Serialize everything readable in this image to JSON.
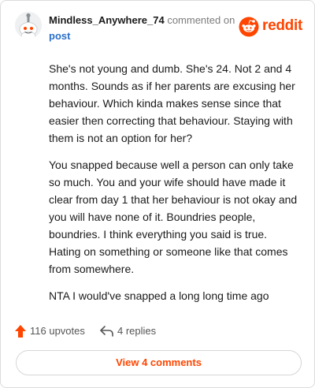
{
  "comment": {
    "username": "Mindless_Anywhere_74",
    "action": "commented on",
    "post_link": "post",
    "brand": "reddit",
    "paragraphs": [
      "She's not young and dumb. She's 24. Not 2 and 4 months. Sounds as if her parents are excusing her behaviour. Which kinda makes sense since that easier then correcting that behaviour. Staying with them is not an option for her?",
      "You snapped because well a person can only take so much. You and your wife should have made it clear from day 1 that her behaviour is not okay and you will have none of it. Boundries people, boundries. I think everything you said is true. Hating on something or someone like that comes from somewhere.",
      "NTA I would've snapped a long long time ago"
    ]
  },
  "stats": {
    "upvotes": "116 upvotes",
    "replies": "4 replies"
  },
  "actions": {
    "view_comments": "View 4 comments"
  },
  "colors": {
    "brand": "#ff4500",
    "link": "#2b6fc9",
    "text": "#1a1a1b",
    "muted": "#7c7c7c"
  },
  "icons": [
    "avatar-snoo-icon",
    "reddit-logo-icon",
    "upvote-arrow-icon",
    "reply-icon"
  ]
}
